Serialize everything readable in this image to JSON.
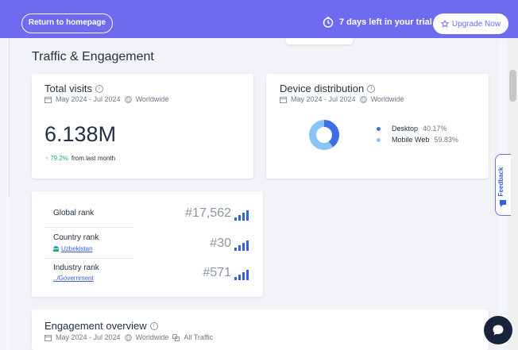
{
  "header": {
    "return_label": "Return to homepage",
    "trial_text": "7 days left in your trial",
    "upgrade_label": "Upgrade Now"
  },
  "page_title": "Traffic & Engagement",
  "total_visits": {
    "title": "Total visits",
    "date_range": "May 2024 - Jul 2024",
    "region": "Worldwide",
    "value": "6.138M",
    "change": "79.2%",
    "change_label": "from last month"
  },
  "device_distribution": {
    "title": "Device distribution",
    "date_range": "May 2024 - Jul 2024",
    "region": "Worldwide",
    "items": [
      {
        "label": "Desktop",
        "value": "40.17%",
        "share": 40.17,
        "color": "#3d6ee8"
      },
      {
        "label": "Mobile Web",
        "value": "59.83%",
        "share": 59.83,
        "color": "#8cc3f6"
      }
    ]
  },
  "ranks": [
    {
      "label": "Global rank",
      "sub": "",
      "value": "#17,562"
    },
    {
      "label": "Country rank",
      "sub": "Uzbekistan",
      "value": "#30"
    },
    {
      "label": "Industry rank",
      "sub": "../Government",
      "value": "#571"
    }
  ],
  "engagement": {
    "title": "Engagement overview",
    "date_range": "May 2024 - Jul 2024",
    "region": "Worldwide",
    "traffic": "All Traffic"
  },
  "feedback_label": "Feedback",
  "colors": {
    "accent": "#6f6bf0",
    "link": "#3662d9",
    "positive": "#2fa66a"
  }
}
